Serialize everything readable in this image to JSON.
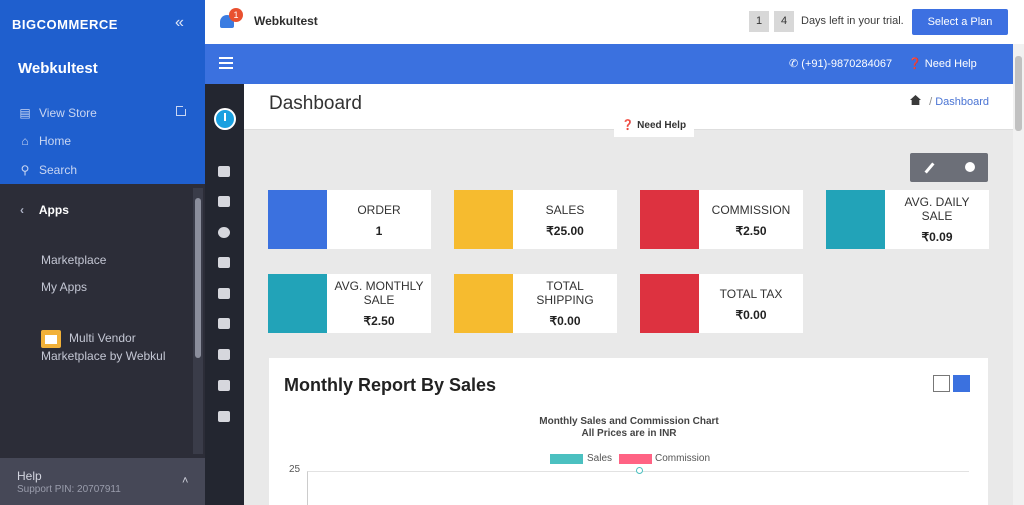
{
  "bigcommerce": {
    "logo": "BIGCOMMERCE",
    "store_name": "Webkultest",
    "nav": [
      "View Store",
      "Home",
      "Search"
    ],
    "apps_title": "Apps",
    "apps_links": [
      "Marketplace",
      "My Apps"
    ],
    "multi_vendor": [
      "Multi Vendor",
      "Marketplace by Webkul"
    ],
    "help_label": "Help",
    "support_pin": "Support PIN: 20707911"
  },
  "topbar": {
    "bell_badge": "1",
    "store_title": "Webkultest",
    "trial_digits": [
      "1",
      "4"
    ],
    "trial_text": "Days left in your trial.",
    "select_plan": "Select a Plan"
  },
  "bluebar": {
    "phone": "(+91)-9870284067",
    "need_help": "Need Help"
  },
  "page": {
    "title": "Dashboard",
    "breadcrumb_sep": "/",
    "breadcrumb_current": "Dashboard",
    "need_help_chip": "Need Help"
  },
  "cards": [
    {
      "label": "ORDER",
      "value": "1",
      "color": "#3b71df",
      "icon": "globe-icon"
    },
    {
      "label": "SALES",
      "value": "₹25.00",
      "color": "#f6bb2f",
      "icon": "dollar-icon"
    },
    {
      "label": "COMMISSION",
      "value": "₹2.50",
      "color": "#dd3240",
      "icon": "dollar-icon"
    },
    {
      "label": "AVG. DAILY SALE",
      "value": "₹0.09",
      "color": "#22a3b8",
      "icon": "trend-icon"
    },
    {
      "label": "AVG. MONTHLY SALE",
      "value": "₹2.50",
      "color": "#22a3b8",
      "icon": "trend-icon"
    },
    {
      "label": "TOTAL SHIPPING",
      "value": "₹0.00",
      "color": "#f6bb2f",
      "icon": "truck-icon"
    },
    {
      "label": "TOTAL TAX",
      "value": "₹0.00",
      "color": "#dd3240",
      "icon": "percent-icon"
    }
  ],
  "report": {
    "title": "Monthly Report By Sales",
    "chart_title": [
      "Monthly Sales and Commission Chart",
      "All Prices are in INR"
    ],
    "legend": [
      "Sales",
      "Commission"
    ],
    "y_tick": "25"
  },
  "chart_data": {
    "type": "line",
    "title": "Monthly Sales and Commission Chart",
    "subtitle": "All Prices are in INR",
    "series": [
      {
        "name": "Sales",
        "color": "#4bc0c0",
        "values": [
          25
        ]
      },
      {
        "name": "Commission",
        "color": "#ff6384",
        "values": []
      }
    ],
    "yticks_visible": [
      25
    ]
  }
}
